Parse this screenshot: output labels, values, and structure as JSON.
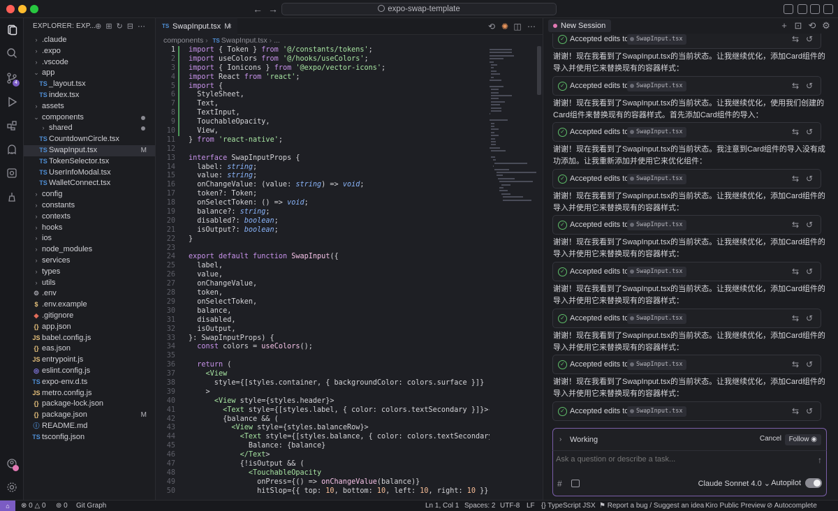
{
  "titlebar": {
    "search_text": "expo-swap-template"
  },
  "sidebar": {
    "header": "EXPLORER: EXP...",
    "items": [
      {
        "label": ".claude",
        "type": "folder",
        "depth": 0,
        "mark": ""
      },
      {
        "label": ".expo",
        "type": "folder",
        "depth": 0,
        "mark": ""
      },
      {
        "label": ".vscode",
        "type": "folder",
        "depth": 0,
        "mark": ""
      },
      {
        "label": "app",
        "type": "folder-open",
        "depth": 0,
        "mark": ""
      },
      {
        "label": "_layout.tsx",
        "type": "ts",
        "depth": 1,
        "mark": ""
      },
      {
        "label": "index.tsx",
        "type": "ts",
        "depth": 1,
        "mark": ""
      },
      {
        "label": "assets",
        "type": "folder",
        "depth": 0,
        "mark": ""
      },
      {
        "label": "components",
        "type": "folder-open",
        "depth": 0,
        "mark": "dot"
      },
      {
        "label": "shared",
        "type": "folder",
        "depth": 1,
        "mark": "dot"
      },
      {
        "label": "CountdownCircle.tsx",
        "type": "ts",
        "depth": 1,
        "mark": ""
      },
      {
        "label": "SwapInput.tsx",
        "type": "ts",
        "depth": 1,
        "mark": "M",
        "selected": true
      },
      {
        "label": "TokenSelector.tsx",
        "type": "ts",
        "depth": 1,
        "mark": ""
      },
      {
        "label": "UserInfoModal.tsx",
        "type": "ts",
        "depth": 1,
        "mark": ""
      },
      {
        "label": "WalletConnect.tsx",
        "type": "ts",
        "depth": 1,
        "mark": ""
      },
      {
        "label": "config",
        "type": "folder",
        "depth": 0,
        "mark": ""
      },
      {
        "label": "constants",
        "type": "folder",
        "depth": 0,
        "mark": ""
      },
      {
        "label": "contexts",
        "type": "folder",
        "depth": 0,
        "mark": ""
      },
      {
        "label": "hooks",
        "type": "folder",
        "depth": 0,
        "mark": ""
      },
      {
        "label": "ios",
        "type": "folder",
        "depth": 0,
        "mark": ""
      },
      {
        "label": "node_modules",
        "type": "folder",
        "depth": 0,
        "mark": ""
      },
      {
        "label": "services",
        "type": "folder",
        "depth": 0,
        "mark": ""
      },
      {
        "label": "types",
        "type": "folder",
        "depth": 0,
        "mark": ""
      },
      {
        "label": "utils",
        "type": "folder",
        "depth": 0,
        "mark": ""
      },
      {
        "label": ".env",
        "type": "gear",
        "depth": 0,
        "mark": ""
      },
      {
        "label": ".env.example",
        "type": "dollar",
        "depth": 0,
        "mark": ""
      },
      {
        "label": ".gitignore",
        "type": "git",
        "depth": 0,
        "mark": ""
      },
      {
        "label": "app.json",
        "type": "json",
        "depth": 0,
        "mark": ""
      },
      {
        "label": "babel.config.js",
        "type": "js",
        "depth": 0,
        "mark": ""
      },
      {
        "label": "eas.json",
        "type": "json",
        "depth": 0,
        "mark": ""
      },
      {
        "label": "entrypoint.js",
        "type": "js",
        "depth": 0,
        "mark": ""
      },
      {
        "label": "eslint.config.js",
        "type": "eslint",
        "depth": 0,
        "mark": ""
      },
      {
        "label": "expo-env.d.ts",
        "type": "ts",
        "depth": 0,
        "mark": ""
      },
      {
        "label": "metro.config.js",
        "type": "js",
        "depth": 0,
        "mark": ""
      },
      {
        "label": "package-lock.json",
        "type": "json",
        "depth": 0,
        "mark": ""
      },
      {
        "label": "package.json",
        "type": "json",
        "depth": 0,
        "mark": "M"
      },
      {
        "label": "README.md",
        "type": "info",
        "depth": 0,
        "mark": ""
      },
      {
        "label": "tsconfig.json",
        "type": "tsconfig",
        "depth": 0,
        "mark": ""
      }
    ]
  },
  "editor": {
    "tab_label": "SwapInput.tsx",
    "tab_modified": "M",
    "tab_icon": "TS",
    "breadcrumb": [
      "components",
      "SwapInput.tsx",
      "..."
    ],
    "lines": [
      {
        "n": 1,
        "t": "import { Token } from '@/constants/tokens';"
      },
      {
        "n": 2,
        "t": "import useColors from '@/hooks/useColors';"
      },
      {
        "n": 3,
        "t": "import { Ionicons } from '@expo/vector-icons';"
      },
      {
        "n": 4,
        "t": "import React from 'react';"
      },
      {
        "n": 5,
        "t": "import {"
      },
      {
        "n": 6,
        "t": "  StyleSheet,"
      },
      {
        "n": 7,
        "t": "  Text,"
      },
      {
        "n": 8,
        "t": "  TextInput,"
      },
      {
        "n": 9,
        "t": "  TouchableOpacity,"
      },
      {
        "n": 10,
        "t": "  View,"
      },
      {
        "n": 11,
        "t": "} from 'react-native';"
      },
      {
        "n": 12,
        "t": ""
      },
      {
        "n": 13,
        "t": "interface SwapInputProps {"
      },
      {
        "n": 14,
        "t": "  label: string;"
      },
      {
        "n": 15,
        "t": "  value: string;"
      },
      {
        "n": 16,
        "t": "  onChangeValue: (value: string) => void;"
      },
      {
        "n": 17,
        "t": "  token?: Token;"
      },
      {
        "n": 18,
        "t": "  onSelectToken: () => void;"
      },
      {
        "n": 19,
        "t": "  balance?: string;"
      },
      {
        "n": 20,
        "t": "  disabled?: boolean;"
      },
      {
        "n": 21,
        "t": "  isOutput?: boolean;"
      },
      {
        "n": 22,
        "t": "}"
      },
      {
        "n": 23,
        "t": ""
      },
      {
        "n": 24,
        "t": "export default function SwapInput({"
      },
      {
        "n": 25,
        "t": "  label,"
      },
      {
        "n": 26,
        "t": "  value,"
      },
      {
        "n": 27,
        "t": "  onChangeValue,"
      },
      {
        "n": 28,
        "t": "  token,"
      },
      {
        "n": 29,
        "t": "  onSelectToken,"
      },
      {
        "n": 30,
        "t": "  balance,"
      },
      {
        "n": 31,
        "t": "  disabled,"
      },
      {
        "n": 32,
        "t": "  isOutput,"
      },
      {
        "n": 33,
        "t": "}: SwapInputProps) {"
      },
      {
        "n": 34,
        "t": "  const colors = useColors();"
      },
      {
        "n": 35,
        "t": ""
      },
      {
        "n": 36,
        "t": "  return ("
      },
      {
        "n": 37,
        "t": "    <View"
      },
      {
        "n": 38,
        "t": "      style={[styles.container, { backgroundColor: colors.surface }]}"
      },
      {
        "n": 39,
        "t": "    >"
      },
      {
        "n": 40,
        "t": "      <View style={styles.header}>"
      },
      {
        "n": 41,
        "t": "        <Text style={[styles.label, { color: colors.textSecondary }]}>{label}</Text>"
      },
      {
        "n": 42,
        "t": "        {balance && ("
      },
      {
        "n": 43,
        "t": "          <View style={styles.balanceRow}>"
      },
      {
        "n": 44,
        "t": "            <Text style={[styles.balance, { color: colors.textSecondary }]}>"
      },
      {
        "n": 45,
        "t": "              Balance: {balance}"
      },
      {
        "n": 46,
        "t": "            </Text>"
      },
      {
        "n": 47,
        "t": "            {!isOutput && ("
      },
      {
        "n": 48,
        "t": "              <TouchableOpacity"
      },
      {
        "n": 49,
        "t": "                onPress={() => onChangeValue(balance)}"
      },
      {
        "n": 50,
        "t": "                hitSlop={{ top: 10, bottom: 10, left: 10, right: 10 }}"
      }
    ]
  },
  "chat": {
    "session_tab": "New Session",
    "accepted_label": "Accepted edits to",
    "accepted_file": "SwapInput.tsx",
    "messages": [
      "谢谢！现在我看到了SwapInput.tsx的当前状态。让我继续优化，添加Card组件的导入并使用它来替换现有的容器样式：",
      "谢谢！现在我看到了SwapInput.tsx的当前状态。让我继续优化，使用我们创建的Card组件来替换现有的容器样式。首先添加Card组件的导入：",
      "谢谢！现在我看到了SwapInput.tsx的当前状态。我注意到Card组件的导入没有成功添加。让我重新添加并使用它来优化组件：",
      "谢谢！现在我看到了SwapInput.tsx的当前状态。让我继续优化，添加Card组件的导入并使用它来替换现有的容器样式：",
      "谢谢！现在我看到了SwapInput.tsx的当前状态。让我继续优化，添加Card组件的导入并使用它来替换现有的容器样式：",
      "谢谢！现在我看到了SwapInput.tsx的当前状态。让我继续优化，添加Card组件的导入并使用它来替换现有的容器样式：",
      "谢谢！现在我看到了SwapInput.tsx的当前状态。让我继续优化，添加Card组件的导入并使用它来替换现有的容器样式：",
      "谢谢！现在我看到了SwapInput.tsx的当前状态。让我继续优化，添加Card组件的导入并使用它来替换现有的容器样式："
    ],
    "working_label": "Working",
    "cancel_label": "Cancel",
    "follow_label": "Follow",
    "input_placeholder": "Ask a question or describe a task...",
    "model": "Claude Sonnet 4.0",
    "autopilot_label": "Autopilot",
    "autopilot_on": true
  },
  "statusbar": {
    "errors": "0",
    "warnings": "0",
    "ports": "0",
    "git_graph": "Git Graph",
    "cursor": "Ln 1, Col 1",
    "spaces": "Spaces: 2",
    "encoding": "UTF-8",
    "eol": "LF",
    "language": "TypeScript JSX",
    "report": "Report a bug / Suggest an idea",
    "preview": "Kiro Public Preview",
    "autocomplete": "Autocomplete"
  },
  "colors": {
    "accent": "#7b5cc4",
    "success": "#5fbf6a",
    "modified_gutter": "#4e9a5a"
  }
}
